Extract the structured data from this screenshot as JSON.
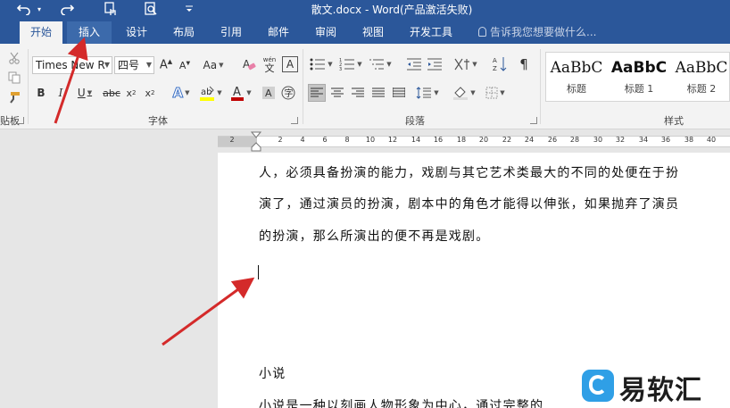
{
  "window": {
    "title": "散文.docx - Word(产品激活失败)",
    "quick_access": [
      "undo-icon",
      "redo-icon",
      "touch-mode-icon",
      "print-preview-icon"
    ]
  },
  "tabs": [
    {
      "label": "开始",
      "state": "active"
    },
    {
      "label": "插入",
      "state": "hover"
    },
    {
      "label": "设计",
      "state": "normal"
    },
    {
      "label": "布局",
      "state": "normal"
    },
    {
      "label": "引用",
      "state": "normal"
    },
    {
      "label": "邮件",
      "state": "normal"
    },
    {
      "label": "审阅",
      "state": "normal"
    },
    {
      "label": "视图",
      "state": "normal"
    },
    {
      "label": "开发工具",
      "state": "normal"
    }
  ],
  "tell_me": "告诉我您想要做什么...",
  "ribbon": {
    "clipboard_label": "贴板",
    "font": {
      "label": "字体",
      "font_name": "Times New R",
      "font_size": "四号",
      "aa_label": "Aa",
      "wen_label": "wén",
      "wen_char": "文",
      "a_char": "A"
    },
    "paragraph_label": "段落",
    "styles": {
      "label": "样式",
      "items": [
        {
          "sample": "AaBbC",
          "name": "标题",
          "bold": false
        },
        {
          "sample": "AaBbC",
          "name": "标题 1",
          "bold": true
        },
        {
          "sample": "AaBbC",
          "name": "标题 2",
          "bold": false
        }
      ]
    }
  },
  "ruler": {
    "labels": [
      "2",
      "2",
      "4",
      "6",
      "8",
      "10",
      "12",
      "14",
      "16",
      "18",
      "20",
      "22",
      "24",
      "26",
      "28",
      "30",
      "32",
      "34",
      "36",
      "38",
      "40"
    ]
  },
  "document": {
    "lines": [
      "人，必须具备扮演的能力，戏剧与其它艺术类最大的不同的处便在于扮",
      "演了，通过演员的扮演，剧本中的角色才能得以伸张，如果抛弃了演员",
      "的扮演，那么所演出的便不再是戏剧。"
    ],
    "heading2": "小说",
    "para2": "小说是一种以刻画人物形象为中心，通过完整的"
  },
  "watermark": {
    "text": "易软汇",
    "logo": "e-logo-icon"
  },
  "colors": {
    "brand": "#2b579a",
    "highlight": "#ffff00",
    "font_color": "#c00000",
    "annotation_arrow": "#d42a2a"
  }
}
